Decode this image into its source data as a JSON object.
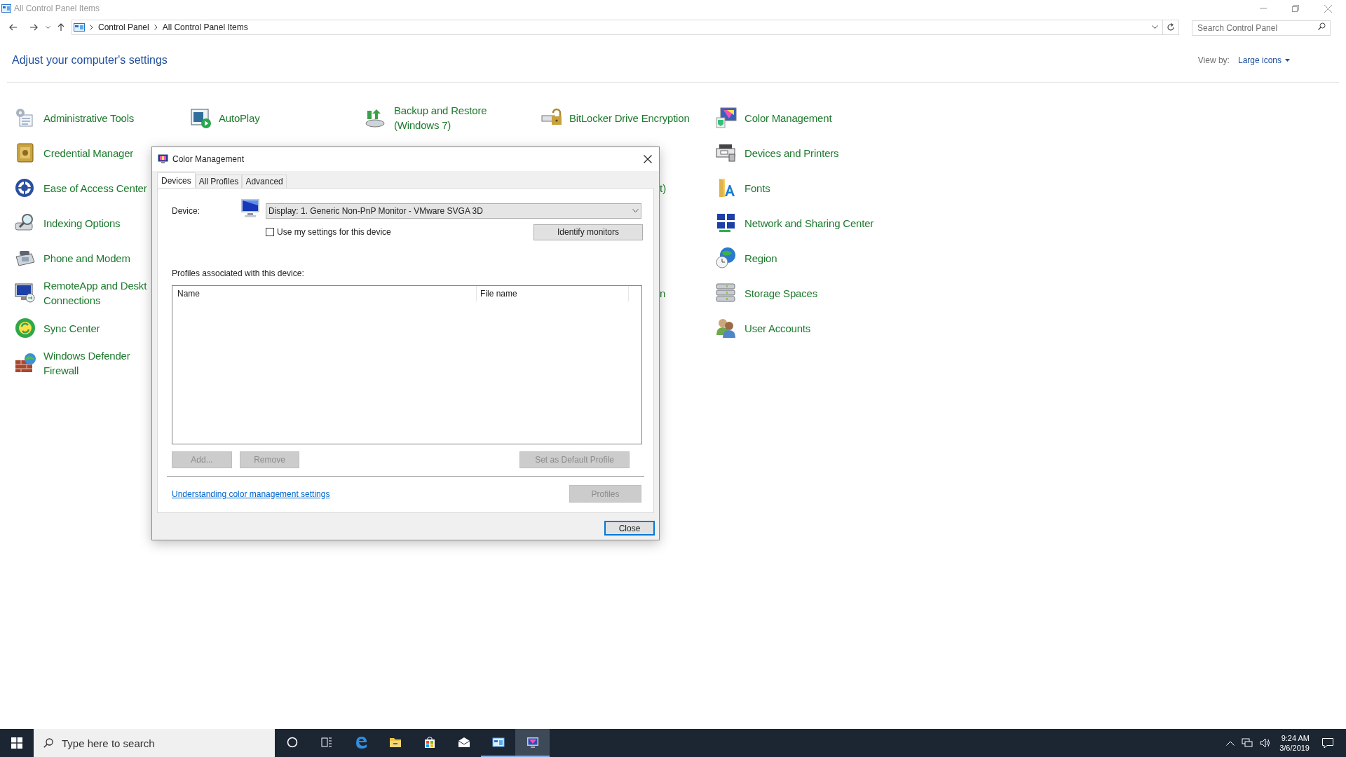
{
  "window": {
    "title": "All Control Panel Items"
  },
  "address_bar": {
    "crumbs": [
      "Control Panel",
      "All Control Panel Items"
    ]
  },
  "search": {
    "placeholder": "Search Control Panel"
  },
  "heading": "Adjust your computer's settings",
  "view_by": {
    "label": "View by:",
    "value": "Large icons"
  },
  "columns": [
    {
      "items": [
        {
          "label": "Administrative Tools",
          "kind": "tools"
        },
        {
          "label": "Credential Manager",
          "kind": "credential"
        },
        {
          "label": "Ease of Access Center",
          "kind": "access"
        },
        {
          "label": "Indexing Options",
          "kind": "indexing"
        },
        {
          "label": "Phone and Modem",
          "kind": "phone"
        },
        {
          "label": "RemoteApp and Deskt Connections",
          "kind": "remote"
        },
        {
          "label": "Sync Center",
          "kind": "sync"
        },
        {
          "label": "Windows Defender Firewall",
          "kind": "firewall"
        }
      ]
    },
    {
      "items": [
        {
          "label": "AutoPlay",
          "kind": "autoplay"
        }
      ]
    },
    {
      "items": [
        {
          "label": "Backup and Restore (Windows 7)",
          "kind": "backup"
        }
      ]
    },
    {
      "items": [
        {
          "label": "BitLocker Drive Encryption",
          "kind": "lock"
        }
      ]
    },
    {
      "items": [
        {
          "label": "Color Management",
          "kind": "color"
        },
        {
          "label": "Devices and Printers",
          "kind": "devices"
        },
        {
          "label": "Fonts",
          "kind": "fonts"
        },
        {
          "label": "Network and Sharing Center",
          "kind": "network"
        },
        {
          "label": "Region",
          "kind": "region"
        },
        {
          "label": "Storage Spaces",
          "kind": "storage"
        },
        {
          "label": "User Accounts",
          "kind": "users"
        }
      ]
    }
  ],
  "covered_fragments": [
    {
      "text": "t)"
    },
    {
      "text": "n"
    }
  ],
  "dialog": {
    "title": "Color Management",
    "tabs": [
      {
        "label": "Devices",
        "selected": true
      },
      {
        "label": "All Profiles",
        "selected": false
      },
      {
        "label": "Advanced",
        "selected": false
      }
    ],
    "device_label": "Device:",
    "device_value": "Display: 1. Generic Non-PnP Monitor - VMware SVGA 3D",
    "use_my_settings": {
      "label": "Use my settings for this device",
      "checked": false
    },
    "identify_button": "Identify monitors",
    "profiles_label": "Profiles associated with this device:",
    "list_columns": [
      "Name",
      "File name"
    ],
    "buttons": [
      {
        "label": "Add...",
        "disabled": true
      },
      {
        "label": "Remove",
        "disabled": true
      },
      {
        "label": "Set as Default Profile",
        "disabled": true
      }
    ],
    "link": "Understanding color management settings",
    "profiles_button": {
      "label": "Profiles",
      "disabled": true
    },
    "close_button": "Close"
  },
  "taskbar": {
    "search_placeholder": "Type here to search",
    "apps": [
      {
        "kind": "cortana",
        "open": false,
        "selected": false
      },
      {
        "kind": "taskview",
        "open": false,
        "selected": false
      },
      {
        "kind": "edge",
        "open": false,
        "selected": false
      },
      {
        "kind": "explorer",
        "open": false,
        "selected": false
      },
      {
        "kind": "store",
        "open": false,
        "selected": false
      },
      {
        "kind": "mail",
        "open": false,
        "selected": false
      },
      {
        "kind": "controlpanel",
        "open": true,
        "selected": false
      },
      {
        "kind": "colormanagement",
        "open": true,
        "selected": true
      }
    ],
    "time": "9:24 AM",
    "date": "3/6/2019"
  }
}
